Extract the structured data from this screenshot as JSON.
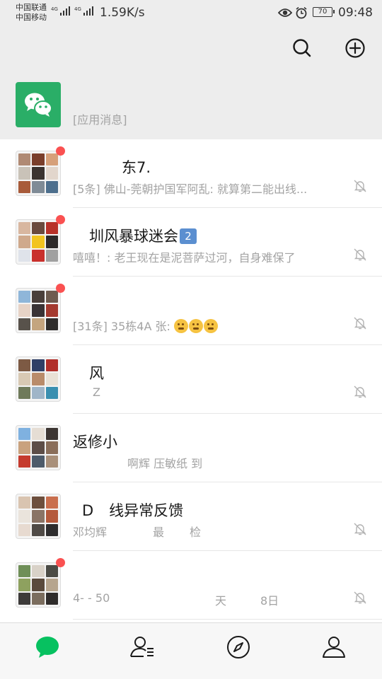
{
  "status_bar": {
    "carrier1": "中国联通",
    "carrier2": "中国移动",
    "net1": "4G",
    "net2": "4G",
    "speed": "1.59K/s",
    "battery": "70",
    "time": "09:48",
    "icons": [
      "eye-icon",
      "alarm-icon",
      "battery-icon"
    ]
  },
  "header": {
    "icons": [
      "search-icon",
      "add-circle-icon"
    ]
  },
  "chats": [
    {
      "title": "",
      "subtitle": "[应用消息]",
      "avatar": "wechat-logo",
      "unread": false,
      "muted": false
    },
    {
      "title": "东7.",
      "subtitle": "[5条] 佛山-莞朝护国军阿乱: 就算第二能出线...",
      "unread": true,
      "muted": true
    },
    {
      "title": "圳风暴球迷会",
      "badge": "2",
      "subtitle": "嘻嘻！: 老王现在是泥菩萨过河，自身难保了",
      "unread": true,
      "muted": true
    },
    {
      "title": "",
      "subtitle": "[31条] 35栋4A 张:",
      "emoji_count": 3,
      "unread": true,
      "muted": true
    },
    {
      "title": "风",
      "subtitle": "Z",
      "unread": false,
      "muted": true
    },
    {
      "title": "返修小",
      "subtitle": "啊辉 压敏纸 到",
      "unread": false,
      "muted": false
    },
    {
      "title_prefix": "D",
      "title": "线异常反馈",
      "subtitle_a": "邓均辉",
      "subtitle_b": "最",
      "subtitle_c": "检",
      "unread": false,
      "muted": true
    },
    {
      "title": "",
      "subtitle_a": "4- - 50",
      "subtitle_b": "天",
      "subtitle_c": "8日",
      "unread": true,
      "muted": true
    }
  ],
  "tabs": [
    {
      "name": "chats",
      "icon": "chat-bubble-icon",
      "active": true
    },
    {
      "name": "contacts",
      "icon": "contacts-icon",
      "active": false
    },
    {
      "name": "discover",
      "icon": "compass-icon",
      "active": false
    },
    {
      "name": "me",
      "icon": "person-icon",
      "active": false
    }
  ],
  "colors": {
    "accent": "#07c160",
    "unread_dot": "#fa5151",
    "background": "#ededed",
    "secondary_text": "#a3a3a3"
  }
}
